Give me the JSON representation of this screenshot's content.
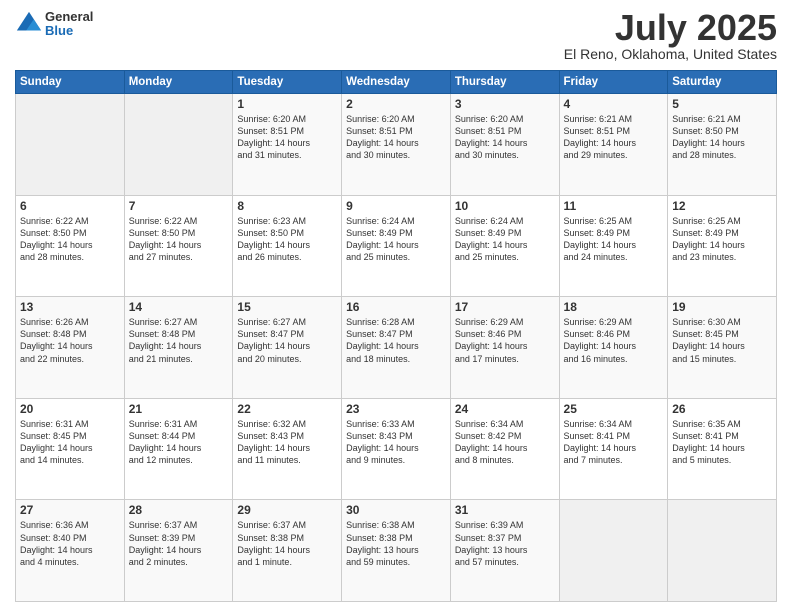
{
  "header": {
    "logo_general": "General",
    "logo_blue": "Blue",
    "title": "July 2025",
    "location": "El Reno, Oklahoma, United States"
  },
  "days_of_week": [
    "Sunday",
    "Monday",
    "Tuesday",
    "Wednesday",
    "Thursday",
    "Friday",
    "Saturday"
  ],
  "weeks": [
    [
      {
        "day": "",
        "info": ""
      },
      {
        "day": "",
        "info": ""
      },
      {
        "day": "1",
        "info": "Sunrise: 6:20 AM\nSunset: 8:51 PM\nDaylight: 14 hours\nand 31 minutes."
      },
      {
        "day": "2",
        "info": "Sunrise: 6:20 AM\nSunset: 8:51 PM\nDaylight: 14 hours\nand 30 minutes."
      },
      {
        "day": "3",
        "info": "Sunrise: 6:20 AM\nSunset: 8:51 PM\nDaylight: 14 hours\nand 30 minutes."
      },
      {
        "day": "4",
        "info": "Sunrise: 6:21 AM\nSunset: 8:51 PM\nDaylight: 14 hours\nand 29 minutes."
      },
      {
        "day": "5",
        "info": "Sunrise: 6:21 AM\nSunset: 8:50 PM\nDaylight: 14 hours\nand 28 minutes."
      }
    ],
    [
      {
        "day": "6",
        "info": "Sunrise: 6:22 AM\nSunset: 8:50 PM\nDaylight: 14 hours\nand 28 minutes."
      },
      {
        "day": "7",
        "info": "Sunrise: 6:22 AM\nSunset: 8:50 PM\nDaylight: 14 hours\nand 27 minutes."
      },
      {
        "day": "8",
        "info": "Sunrise: 6:23 AM\nSunset: 8:50 PM\nDaylight: 14 hours\nand 26 minutes."
      },
      {
        "day": "9",
        "info": "Sunrise: 6:24 AM\nSunset: 8:49 PM\nDaylight: 14 hours\nand 25 minutes."
      },
      {
        "day": "10",
        "info": "Sunrise: 6:24 AM\nSunset: 8:49 PM\nDaylight: 14 hours\nand 25 minutes."
      },
      {
        "day": "11",
        "info": "Sunrise: 6:25 AM\nSunset: 8:49 PM\nDaylight: 14 hours\nand 24 minutes."
      },
      {
        "day": "12",
        "info": "Sunrise: 6:25 AM\nSunset: 8:49 PM\nDaylight: 14 hours\nand 23 minutes."
      }
    ],
    [
      {
        "day": "13",
        "info": "Sunrise: 6:26 AM\nSunset: 8:48 PM\nDaylight: 14 hours\nand 22 minutes."
      },
      {
        "day": "14",
        "info": "Sunrise: 6:27 AM\nSunset: 8:48 PM\nDaylight: 14 hours\nand 21 minutes."
      },
      {
        "day": "15",
        "info": "Sunrise: 6:27 AM\nSunset: 8:47 PM\nDaylight: 14 hours\nand 20 minutes."
      },
      {
        "day": "16",
        "info": "Sunrise: 6:28 AM\nSunset: 8:47 PM\nDaylight: 14 hours\nand 18 minutes."
      },
      {
        "day": "17",
        "info": "Sunrise: 6:29 AM\nSunset: 8:46 PM\nDaylight: 14 hours\nand 17 minutes."
      },
      {
        "day": "18",
        "info": "Sunrise: 6:29 AM\nSunset: 8:46 PM\nDaylight: 14 hours\nand 16 minutes."
      },
      {
        "day": "19",
        "info": "Sunrise: 6:30 AM\nSunset: 8:45 PM\nDaylight: 14 hours\nand 15 minutes."
      }
    ],
    [
      {
        "day": "20",
        "info": "Sunrise: 6:31 AM\nSunset: 8:45 PM\nDaylight: 14 hours\nand 14 minutes."
      },
      {
        "day": "21",
        "info": "Sunrise: 6:31 AM\nSunset: 8:44 PM\nDaylight: 14 hours\nand 12 minutes."
      },
      {
        "day": "22",
        "info": "Sunrise: 6:32 AM\nSunset: 8:43 PM\nDaylight: 14 hours\nand 11 minutes."
      },
      {
        "day": "23",
        "info": "Sunrise: 6:33 AM\nSunset: 8:43 PM\nDaylight: 14 hours\nand 9 minutes."
      },
      {
        "day": "24",
        "info": "Sunrise: 6:34 AM\nSunset: 8:42 PM\nDaylight: 14 hours\nand 8 minutes."
      },
      {
        "day": "25",
        "info": "Sunrise: 6:34 AM\nSunset: 8:41 PM\nDaylight: 14 hours\nand 7 minutes."
      },
      {
        "day": "26",
        "info": "Sunrise: 6:35 AM\nSunset: 8:41 PM\nDaylight: 14 hours\nand 5 minutes."
      }
    ],
    [
      {
        "day": "27",
        "info": "Sunrise: 6:36 AM\nSunset: 8:40 PM\nDaylight: 14 hours\nand 4 minutes."
      },
      {
        "day": "28",
        "info": "Sunrise: 6:37 AM\nSunset: 8:39 PM\nDaylight: 14 hours\nand 2 minutes."
      },
      {
        "day": "29",
        "info": "Sunrise: 6:37 AM\nSunset: 8:38 PM\nDaylight: 14 hours\nand 1 minute."
      },
      {
        "day": "30",
        "info": "Sunrise: 6:38 AM\nSunset: 8:38 PM\nDaylight: 13 hours\nand 59 minutes."
      },
      {
        "day": "31",
        "info": "Sunrise: 6:39 AM\nSunset: 8:37 PM\nDaylight: 13 hours\nand 57 minutes."
      },
      {
        "day": "",
        "info": ""
      },
      {
        "day": "",
        "info": ""
      }
    ]
  ]
}
